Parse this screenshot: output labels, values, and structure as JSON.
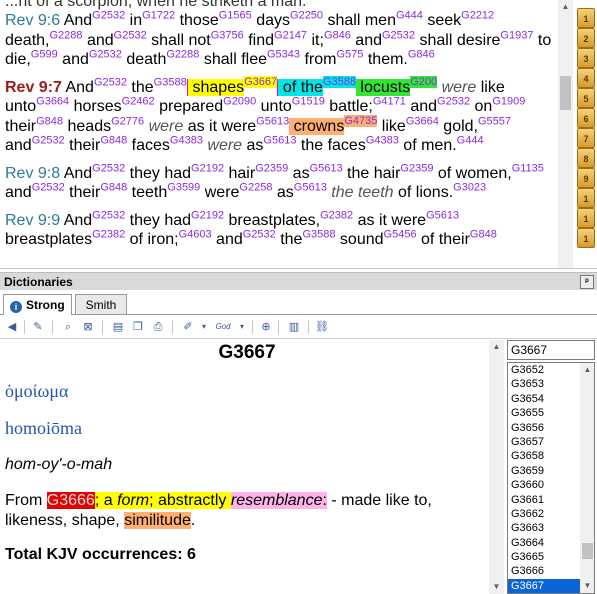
{
  "bible": {
    "partial_line": "...nt of a scorpion, when he striketh a man.",
    "verses": [
      {
        "ref": "Rev 9:6",
        "parts": [
          {
            "t": " And"
          },
          {
            "s": "G2532"
          },
          {
            "t": " in"
          },
          {
            "s": "G1722"
          },
          {
            "t": " those"
          },
          {
            "s": "G1565"
          },
          {
            "t": " days"
          },
          {
            "s": "G2250"
          },
          {
            "t": " shall men"
          },
          {
            "s": "G444"
          },
          {
            "t": " seek"
          },
          {
            "s": "G2212"
          },
          {
            "t": " death,"
          },
          {
            "s": "G2288"
          },
          {
            "t": " and"
          },
          {
            "s": "G2532"
          },
          {
            "t": " shall not"
          },
          {
            "s": "G3756"
          },
          {
            "t": " find"
          },
          {
            "s": "G2147"
          },
          {
            "t": " it;"
          },
          {
            "s": "G846"
          },
          {
            "t": " and"
          },
          {
            "s": "G2532"
          },
          {
            "t": " shall"
          },
          {
            "t": " desire"
          },
          {
            "s": "G1937"
          },
          {
            "t": " to die,"
          },
          {
            "s": "G599"
          },
          {
            "t": " and"
          },
          {
            "s": "G2532"
          },
          {
            "t": " death"
          },
          {
            "s": "G2288"
          },
          {
            "t": " shall flee"
          },
          {
            "s": "G5343"
          },
          {
            "t": " from"
          },
          {
            "s": "G575"
          },
          {
            "t": " them."
          },
          {
            "s": "G846"
          }
        ]
      },
      {
        "ref": "Rev 9:7",
        "current": true,
        "parts": [
          {
            "t": " And"
          },
          {
            "s": "G2532"
          },
          {
            "t": " the"
          },
          {
            "s": "G3588"
          },
          {
            "t": " shapes",
            "c": "yel",
            "lead": "mag"
          },
          {
            "s": "G3667",
            "c": "yel"
          },
          {
            "t": " of the",
            "c": "cyan",
            "lead": "mag"
          },
          {
            "s": "G3588",
            "c": "cyan"
          },
          {
            "t": " locusts",
            "c": "green"
          },
          {
            "s": "G200",
            "c": "green"
          },
          {
            "t": " were",
            "i": true
          },
          {
            "t": " like"
          },
          {
            "t": " unto"
          },
          {
            "s": "G3664"
          },
          {
            "t": " horses"
          },
          {
            "s": "G2462"
          },
          {
            "t": " prepared"
          },
          {
            "s": "G2090"
          },
          {
            "t": " unto"
          },
          {
            "s": "G1519"
          },
          {
            "t": " battle;"
          },
          {
            "s": "G4171"
          },
          {
            "t": " and"
          },
          {
            "s": "G2532"
          },
          {
            "t": " on"
          },
          {
            "s": "G1909"
          },
          {
            "t": " their"
          },
          {
            "s": "G848"
          },
          {
            "t": " heads"
          },
          {
            "s": "G2776"
          },
          {
            "t": " were",
            "i": true
          },
          {
            "t": " as it were"
          },
          {
            "s": "G5613"
          },
          {
            "t": " crowns",
            "c": "orange"
          },
          {
            "s": "G4735",
            "c": "orange"
          },
          {
            "t": " like"
          },
          {
            "s": "G3664"
          },
          {
            "t": " gold,"
          },
          {
            "s": "G5557"
          },
          {
            "t": " and"
          },
          {
            "s": "G2532"
          },
          {
            "t": " their"
          },
          {
            "s": "G848"
          },
          {
            "t": " faces"
          },
          {
            "s": "G4383"
          },
          {
            "t": " were",
            "i": true
          },
          {
            "t": " as"
          },
          {
            "s": "G5613"
          },
          {
            "t": " the faces"
          },
          {
            "s": "G4383"
          },
          {
            "t": " of men."
          },
          {
            "s": "G444"
          }
        ]
      },
      {
        "ref": "Rev 9:8",
        "parts": [
          {
            "t": " And"
          },
          {
            "s": "G2532"
          },
          {
            "t": " they had"
          },
          {
            "s": "G2192"
          },
          {
            "t": " hair"
          },
          {
            "s": "G2359"
          },
          {
            "t": " as"
          },
          {
            "s": "G5613"
          },
          {
            "t": " the hair"
          },
          {
            "s": "G2359"
          },
          {
            "t": " of"
          },
          {
            "t": " women,"
          },
          {
            "s": "G1135"
          },
          {
            "t": " and"
          },
          {
            "s": "G2532"
          },
          {
            "t": " their"
          },
          {
            "s": "G848"
          },
          {
            "t": " teeth"
          },
          {
            "s": "G3599"
          },
          {
            "t": " were"
          },
          {
            "s": "G2258"
          },
          {
            "t": " as"
          },
          {
            "s": "G5613"
          },
          {
            "t": " the teeth",
            "i": true
          },
          {
            "t": " of"
          },
          {
            "t": " lions."
          },
          {
            "s": "G3023"
          }
        ]
      },
      {
        "ref": "Rev 9:9",
        "parts": [
          {
            "t": " And"
          },
          {
            "s": "G2532"
          },
          {
            "t": " they had"
          },
          {
            "s": "G2192"
          },
          {
            "t": " breastplates,"
          },
          {
            "s": "G2382"
          },
          {
            "t": " as it were"
          },
          {
            "s": "G5613"
          },
          {
            "t": " breastplates"
          },
          {
            "s": "G2382"
          },
          {
            "t": " of iron;"
          },
          {
            "s": "G4603"
          },
          {
            "t": " and"
          },
          {
            "s": "G2532"
          },
          {
            "t": " the"
          },
          {
            "s": "G3588"
          },
          {
            "t": " sound"
          },
          {
            "s": "G5456"
          },
          {
            "t": " of their"
          },
          {
            "s": "G848"
          }
        ]
      }
    ]
  },
  "book_tabs": [
    "1",
    "2",
    "3",
    "4",
    "5",
    "6",
    "7",
    "8",
    "9",
    "1",
    "1",
    "1"
  ],
  "panel": {
    "title": "Dictionaries",
    "pin": "ᵖ"
  },
  "tabs": [
    {
      "label": "Strong",
      "active": true
    },
    {
      "label": "Smith",
      "active": false
    }
  ],
  "dictionary": {
    "entry": "G3667",
    "greek": "ὁμοίωμα",
    "transliteration": "homoiōma",
    "pronunciation": "hom-oy'-o-mah",
    "definition": [
      {
        "t": "From "
      },
      {
        "t": "G3666",
        "c": "red"
      },
      {
        "t": "; a ",
        "c": "yel"
      },
      {
        "t": "form",
        "c": "yel",
        "i": true
      },
      {
        "t": "; abstractly ",
        "c": "yel"
      },
      {
        "t": "resemblance",
        "c": "pink",
        "i": true
      },
      {
        "t": ":",
        "c": "pink"
      },
      {
        "t": " - made like to, likeness, shape, "
      },
      {
        "t": "similitude",
        "c": "orange"
      },
      {
        "t": "."
      }
    ],
    "occurrences": "Total KJV occurrences: 6"
  },
  "search": {
    "value": "G3667"
  },
  "list": {
    "items": [
      "G3652",
      "G3653",
      "G3654",
      "G3655",
      "G3656",
      "G3657",
      "G3658",
      "G3659",
      "G3660",
      "G3661",
      "G3662",
      "G3663",
      "G3664",
      "G3665",
      "G3666",
      "G3667"
    ],
    "selected": "G3667"
  }
}
